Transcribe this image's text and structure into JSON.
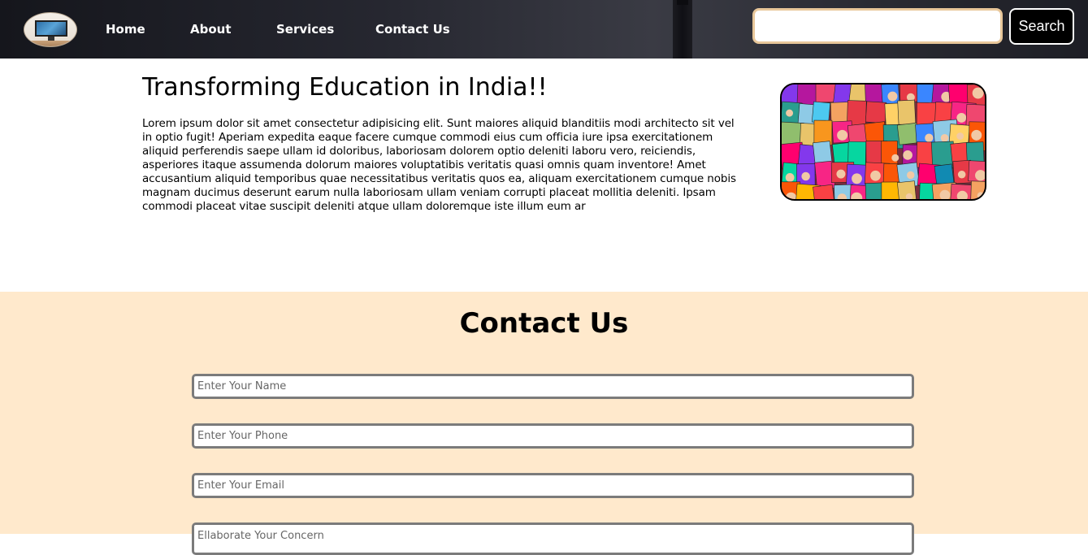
{
  "navbar": {
    "logo_icon": "desktop-monitor-logo-icon",
    "links": [
      {
        "label": "Home"
      },
      {
        "label": "About"
      },
      {
        "label": "Services"
      },
      {
        "label": "Contact Us"
      }
    ],
    "search": {
      "value": "",
      "placeholder": ""
    },
    "search_button_label": "Search",
    "colors": {
      "search_border": "#e8c79a",
      "navbar_bg": "#1d1e25"
    }
  },
  "hero": {
    "title": "Transforming Education in India!!",
    "text": "Lorem ipsum dolor sit amet consectetur adipisicing elit. Sunt maiores aliquid blanditiis modi architecto sit vel in optio fugit! Aperiam expedita eaque facere cumque commodi eius cum officia iure ipsa exercitationem aliquid perferendis saepe ullam id doloribus, laboriosam dolorem optio deleniti laboru vero, reiciendis, asperiores itaque assumenda dolorum maiores voluptatibis veritatis quasi omnis quam inventore! Amet accusantium aliquid temporibus quae necessitatibus veritatis quos ea, aliquam exercitationem cumque nobis magnam ducimus deserunt earum nulla laboriosam ullam veniam corrupti placeat mollitia deleniti. Ipsam commodi placeat vitae suscipit deleniti atque ullam doloremque iste illum eum ar",
    "image_icon": "books-collage-image"
  },
  "contact": {
    "title": "Contact Us",
    "background": "#ffe9cc",
    "fields": {
      "name_placeholder": "Enter Your Name",
      "phone_placeholder": "Enter Your Phone",
      "email_placeholder": "Enter Your Email",
      "concern_placeholder": "Ellaborate Your Concern"
    }
  }
}
